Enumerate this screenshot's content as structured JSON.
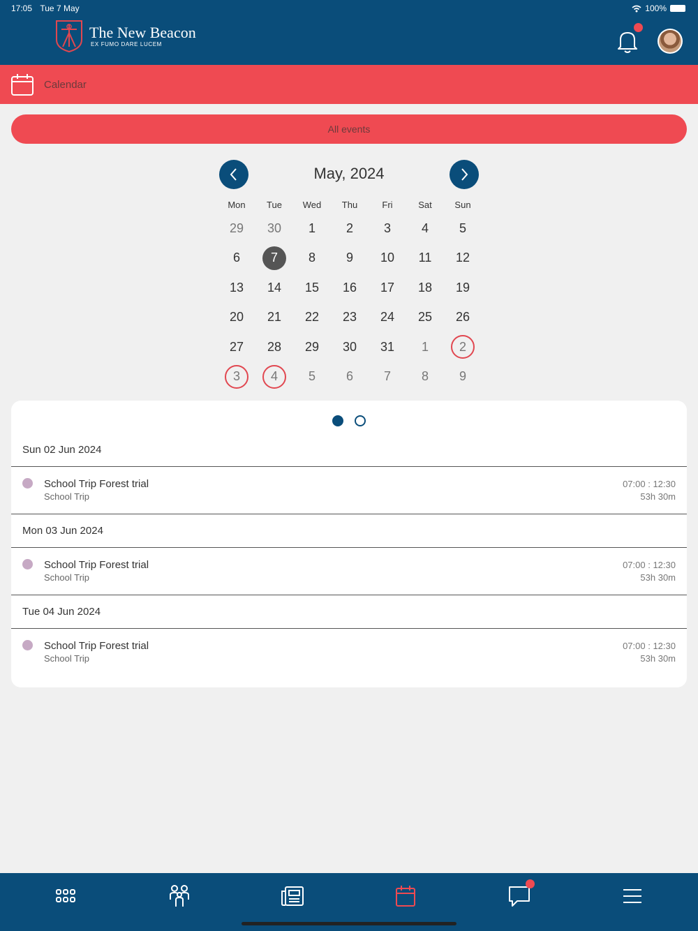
{
  "status_bar": {
    "time": "17:05",
    "date": "Tue 7 May",
    "battery": "100%"
  },
  "brand": {
    "name": "The New Beacon",
    "motto": "EX FUMO DARE LUCEM"
  },
  "section": {
    "title": "Calendar"
  },
  "filter": {
    "label": "All events"
  },
  "calendar": {
    "month_label": "May, 2024",
    "weekdays": [
      "Mon",
      "Tue",
      "Wed",
      "Thu",
      "Fri",
      "Sat",
      "Sun"
    ],
    "weeks": [
      [
        {
          "d": "29",
          "o": true
        },
        {
          "d": "30",
          "o": true
        },
        {
          "d": "1"
        },
        {
          "d": "2"
        },
        {
          "d": "3"
        },
        {
          "d": "4"
        },
        {
          "d": "5"
        }
      ],
      [
        {
          "d": "6"
        },
        {
          "d": "7",
          "today": true
        },
        {
          "d": "8"
        },
        {
          "d": "9"
        },
        {
          "d": "10"
        },
        {
          "d": "11"
        },
        {
          "d": "12"
        }
      ],
      [
        {
          "d": "13"
        },
        {
          "d": "14"
        },
        {
          "d": "15"
        },
        {
          "d": "16"
        },
        {
          "d": "17"
        },
        {
          "d": "18"
        },
        {
          "d": "19"
        }
      ],
      [
        {
          "d": "20"
        },
        {
          "d": "21"
        },
        {
          "d": "22"
        },
        {
          "d": "23"
        },
        {
          "d": "24"
        },
        {
          "d": "25"
        },
        {
          "d": "26"
        }
      ],
      [
        {
          "d": "27"
        },
        {
          "d": "28"
        },
        {
          "d": "29"
        },
        {
          "d": "30"
        },
        {
          "d": "31"
        },
        {
          "d": "1",
          "o": true
        },
        {
          "d": "2",
          "o": true,
          "event": true
        }
      ],
      [
        {
          "d": "3",
          "o": true,
          "event": true
        },
        {
          "d": "4",
          "o": true,
          "event": true
        },
        {
          "d": "5",
          "o": true
        },
        {
          "d": "6",
          "o": true
        },
        {
          "d": "7",
          "o": true
        },
        {
          "d": "8",
          "o": true
        },
        {
          "d": "9",
          "o": true
        }
      ]
    ]
  },
  "pager": {
    "pages": 2,
    "active": 0
  },
  "event_groups": [
    {
      "date": "Sun 02 Jun 2024",
      "events": [
        {
          "title": "School Trip Forest trial",
          "category": "School Trip",
          "start": "07:00",
          "end": "12:30",
          "duration": "53h 30m"
        }
      ]
    },
    {
      "date": "Mon 03 Jun 2024",
      "events": [
        {
          "title": "School Trip Forest trial",
          "category": "School Trip",
          "start": "07:00",
          "end": "12:30",
          "duration": "53h 30m"
        }
      ]
    },
    {
      "date": "Tue 04 Jun 2024",
      "events": [
        {
          "title": "School Trip Forest trial",
          "category": "School Trip",
          "start": "07:00",
          "end": "12:30",
          "duration": "53h 30m"
        }
      ]
    }
  ],
  "tabs": [
    {
      "name": "apps-icon",
      "active": false
    },
    {
      "name": "people-icon",
      "active": false
    },
    {
      "name": "news-icon",
      "active": false
    },
    {
      "name": "calendar-icon",
      "active": true
    },
    {
      "name": "chat-icon",
      "active": false,
      "badge": true
    },
    {
      "name": "menu-icon",
      "active": false
    }
  ],
  "colors": {
    "primary": "#0a4d7a",
    "accent": "#ef4a52",
    "event_dot": "#c6a9c4",
    "today": "#555555"
  }
}
